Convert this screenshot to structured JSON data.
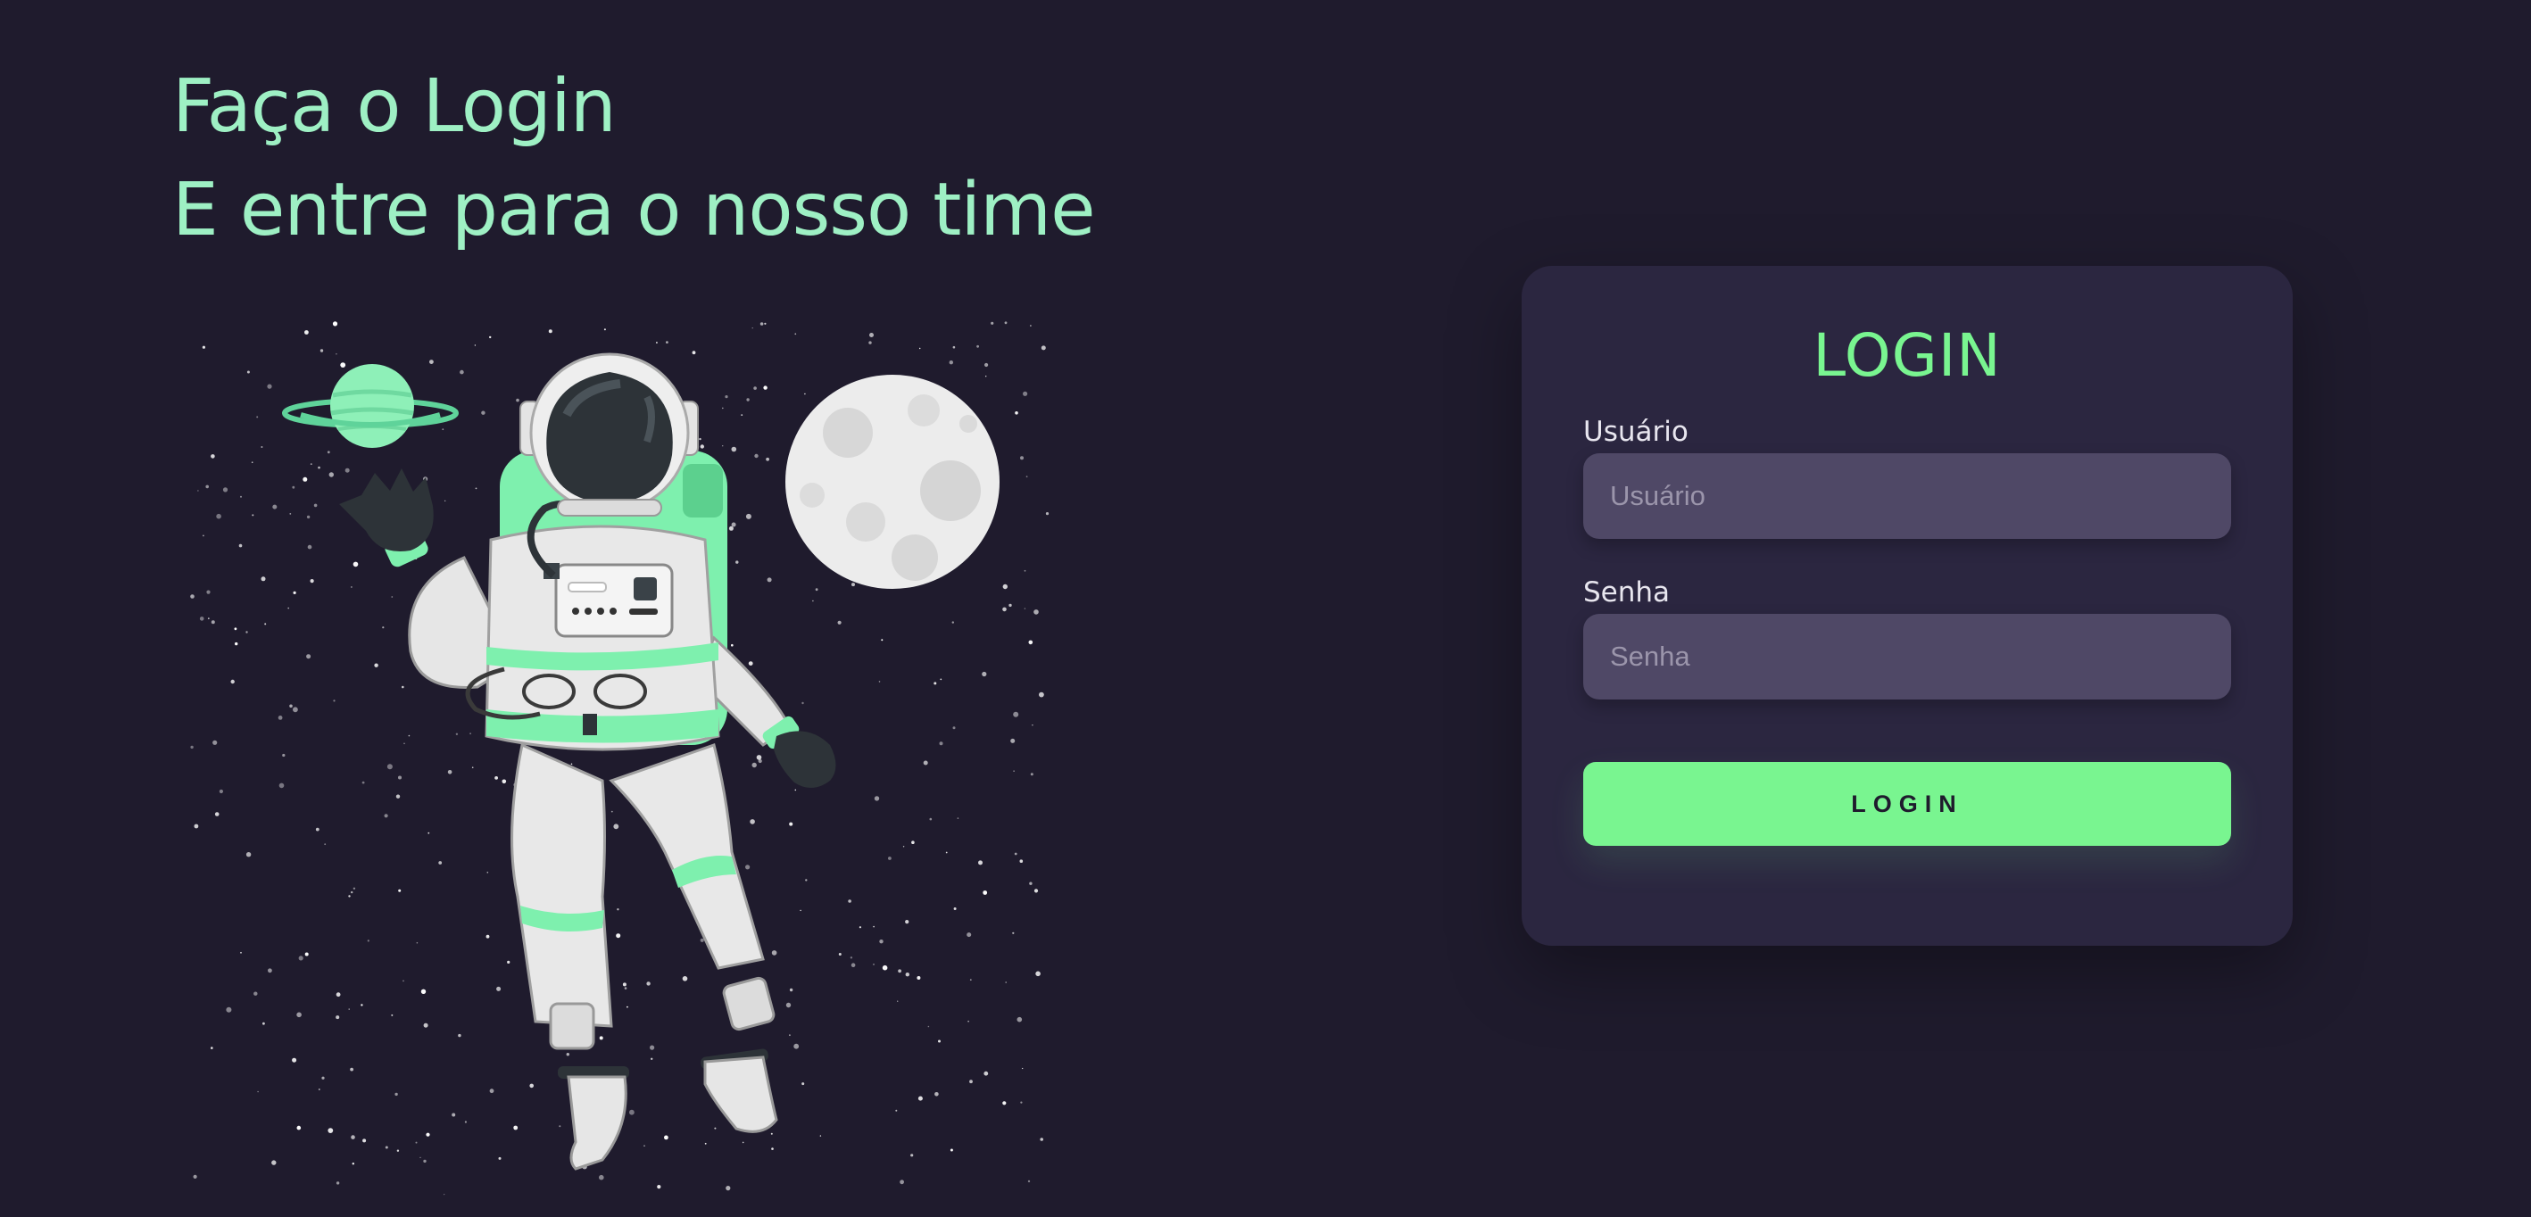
{
  "headline": {
    "line1": "Faça o Login",
    "line2": "E entre para o nosso time"
  },
  "login_card": {
    "title": "LOGIN",
    "username": {
      "label": "Usuário",
      "placeholder": "Usuário",
      "value": ""
    },
    "password": {
      "label": "Senha",
      "placeholder": "Senha",
      "value": ""
    },
    "submit_label": "LOGIN"
  },
  "illustration": {
    "name": "astronaut-floating-in-space",
    "elements": [
      "planet-icon",
      "moon-icon",
      "astronaut-icon",
      "stars"
    ]
  },
  "colors": {
    "background": "#1f1b2d",
    "card": "#2b2640",
    "input": "#4f4866",
    "accent": "#79f590",
    "headline": "#9ef0c4"
  }
}
